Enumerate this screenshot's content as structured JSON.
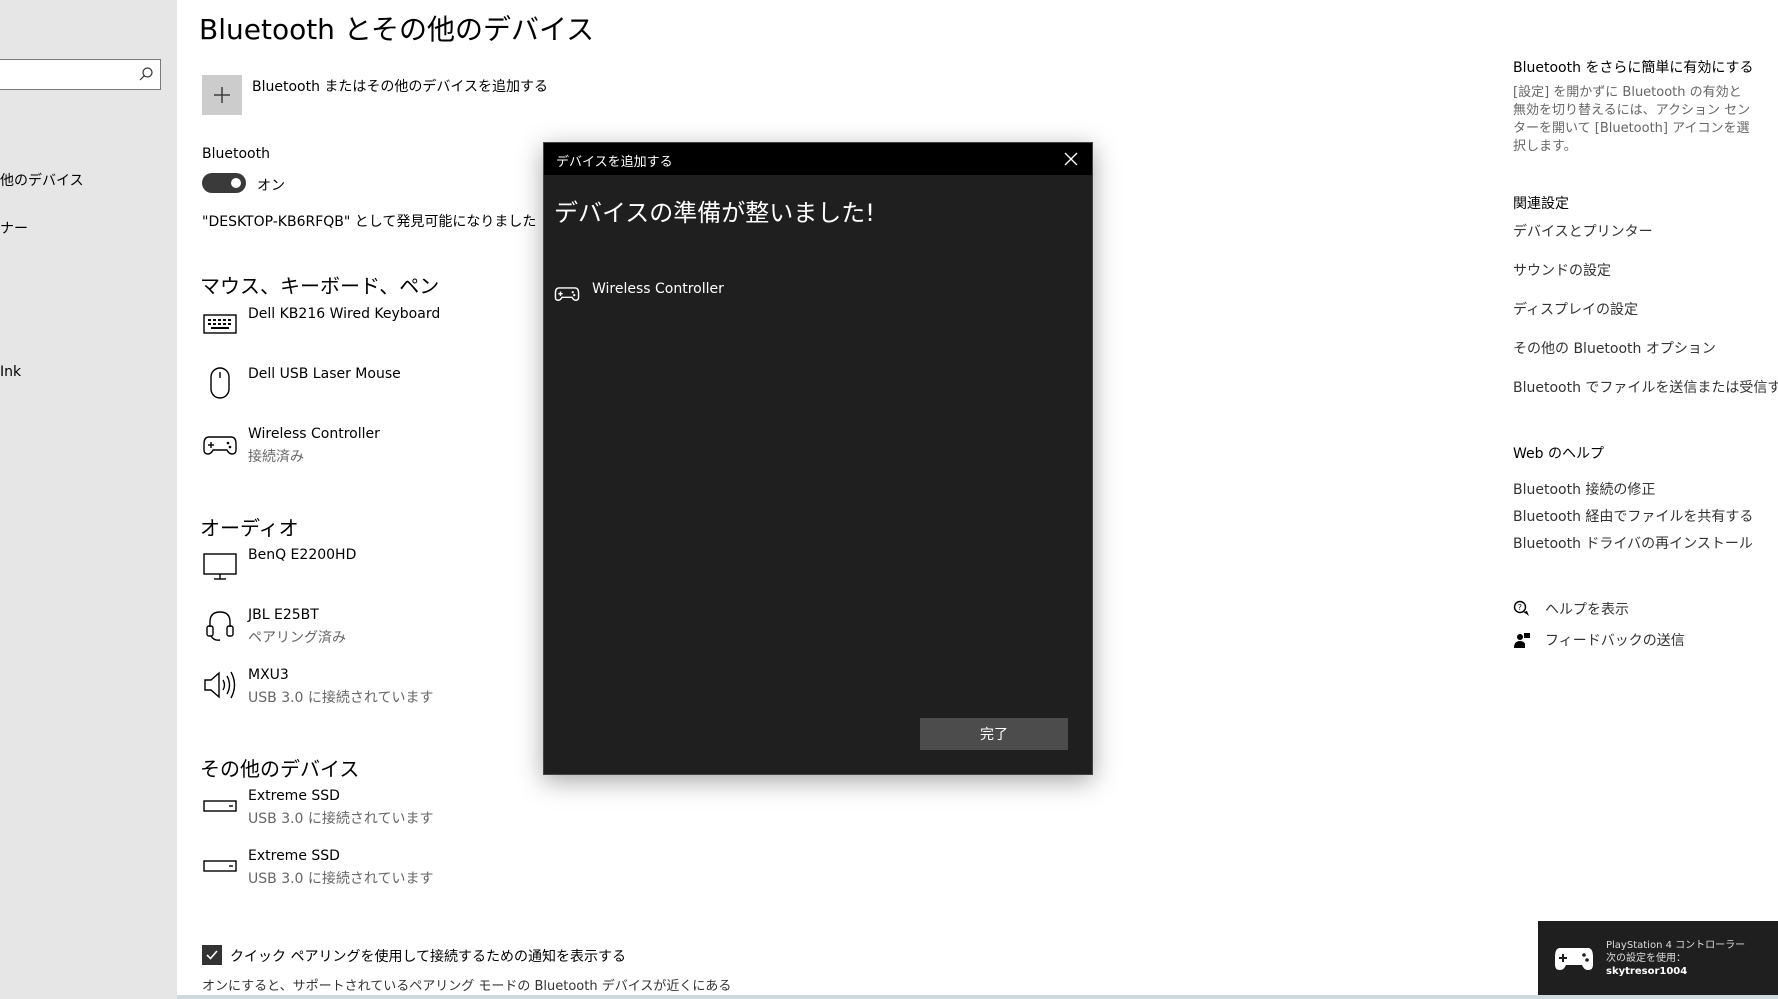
{
  "sidebar": {
    "items": [
      "他のデバイス",
      "ナー",
      "Ink"
    ]
  },
  "main": {
    "title": "Bluetooth とその他のデバイス",
    "add_label": "Bluetooth またはその他のデバイスを追加する",
    "bluetooth_label": "Bluetooth",
    "toggle_state": "オン",
    "discoverable": "\"DESKTOP-KB6RFQB\" として発見可能になりました",
    "sections": {
      "input": {
        "heading": "マウス、キーボード、ペン",
        "devices": [
          {
            "name": "Dell KB216 Wired Keyboard",
            "status": "",
            "icon": "keyboard-icon"
          },
          {
            "name": "Dell USB Laser Mouse",
            "status": "",
            "icon": "mouse-icon"
          },
          {
            "name": "Wireless Controller",
            "status": "接続済み",
            "icon": "gamepad-icon"
          }
        ]
      },
      "audio": {
        "heading": "オーディオ",
        "devices": [
          {
            "name": "BenQ E2200HD",
            "status": "",
            "icon": "monitor-icon"
          },
          {
            "name": "JBL E25BT",
            "status": "ペアリング済み",
            "icon": "headset-icon"
          },
          {
            "name": "MXU3",
            "status": "USB 3.0 に接続されています",
            "icon": "speaker-icon"
          }
        ]
      },
      "other": {
        "heading": "その他のデバイス",
        "devices": [
          {
            "name": "Extreme SSD",
            "status": "USB 3.0 に接続されています",
            "icon": "drive-icon"
          },
          {
            "name": "Extreme SSD",
            "status": "USB 3.0 に接続されています",
            "icon": "drive-icon"
          }
        ]
      }
    },
    "swift_pair_label": "クイック ペアリングを使用して接続するための通知を表示する",
    "swift_pair_desc": "オンにすると、サポートされているペアリング モードの Bluetooth デバイスが近くにある"
  },
  "right": {
    "easy_heading": "Bluetooth をさらに簡単に有効にする",
    "easy_desc": "[設定] を開かずに Bluetooth の有効と無効を切り替えるには、アクション センターを開いて [Bluetooth] アイコンを選択します。",
    "related_heading": "関連設定",
    "related_links": [
      "デバイスとプリンター",
      "サウンドの設定",
      "ディスプレイの設定",
      "その他の Bluetooth オプション",
      "Bluetooth でファイルを送信または受信する"
    ],
    "web_heading": "Web のヘルプ",
    "web_links": [
      "Bluetooth 接続の修正",
      "Bluetooth 経由でファイルを共有する",
      "Bluetooth ドライバの再インストール"
    ],
    "help_label": "ヘルプを表示",
    "feedback_label": "フィードバックの送信"
  },
  "dialog": {
    "title": "デバイスを追加する",
    "heading": "デバイスの準備が整いました!",
    "device_name": "Wireless Controller",
    "done_label": "完了"
  },
  "toast": {
    "line1": "PlayStation 4 コントローラー",
    "line2": "次の設定を使用：",
    "line3": "skytresor1004"
  }
}
